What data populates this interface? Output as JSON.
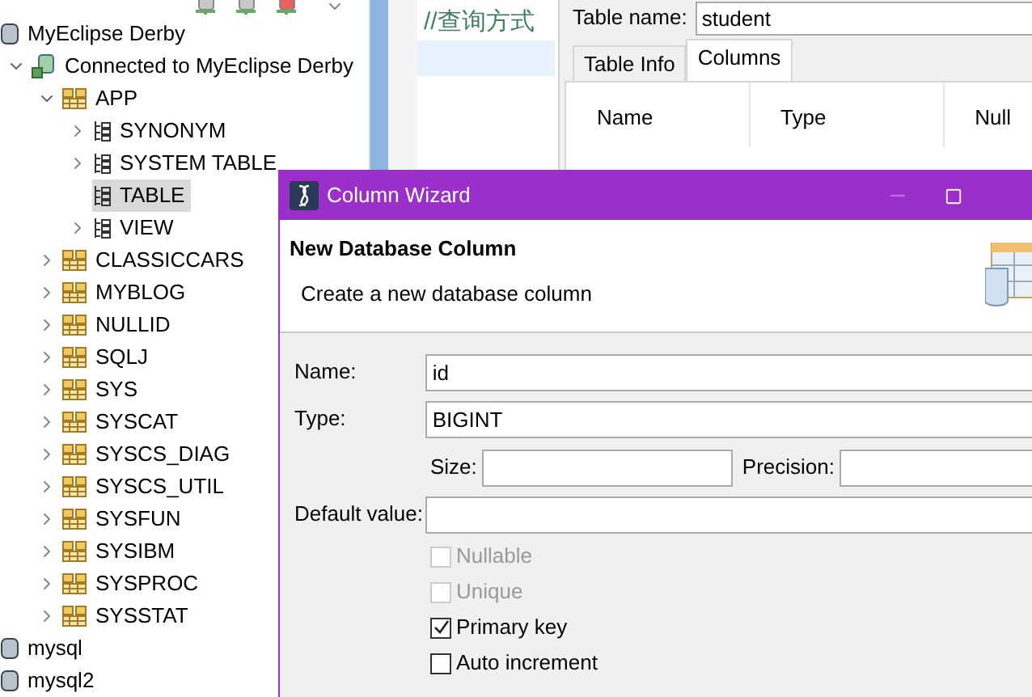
{
  "tree": [
    {
      "label": "MyEclipse Derby",
      "kind": "database",
      "selected": false,
      "children": [
        {
          "label": "Connected to MyEclipse Derby",
          "kind": "connection",
          "expanded": true,
          "selected": false,
          "children": [
            {
              "label": "APP",
              "kind": "schema",
              "expanded": true,
              "selected": false,
              "children": [
                {
                  "label": "SYNONYM",
                  "kind": "folder",
                  "expanded": false,
                  "selected": false
                },
                {
                  "label": "SYSTEM TABLE",
                  "kind": "folder",
                  "expanded": false,
                  "selected": false
                },
                {
                  "label": "TABLE",
                  "kind": "folder",
                  "selected": true
                },
                {
                  "label": "VIEW",
                  "kind": "folder",
                  "expanded": false,
                  "selected": false
                }
              ]
            },
            {
              "label": "CLASSICCARS",
              "kind": "schema",
              "expanded": false,
              "selected": false
            },
            {
              "label": "MYBLOG",
              "kind": "schema",
              "expanded": false,
              "selected": false
            },
            {
              "label": "NULLID",
              "kind": "schema",
              "expanded": false,
              "selected": false
            },
            {
              "label": "SQLJ",
              "kind": "schema",
              "expanded": false,
              "selected": false
            },
            {
              "label": "SYS",
              "kind": "schema",
              "expanded": false,
              "selected": false
            },
            {
              "label": "SYSCAT",
              "kind": "schema",
              "expanded": false,
              "selected": false
            },
            {
              "label": "SYSCS_DIAG",
              "kind": "schema",
              "expanded": false,
              "selected": false
            },
            {
              "label": "SYSCS_UTIL",
              "kind": "schema",
              "expanded": false,
              "selected": false
            },
            {
              "label": "SYSFUN",
              "kind": "schema",
              "expanded": false,
              "selected": false
            },
            {
              "label": "SYSIBM",
              "kind": "schema",
              "expanded": false,
              "selected": false
            },
            {
              "label": "SYSPROC",
              "kind": "schema",
              "expanded": false,
              "selected": false
            },
            {
              "label": "SYSSTAT",
              "kind": "schema",
              "expanded": false,
              "selected": false
            }
          ]
        }
      ]
    },
    {
      "label": "mysql",
      "kind": "database",
      "selected": false
    },
    {
      "label": "mysql2",
      "kind": "database",
      "selected": false
    }
  ],
  "editor": {
    "lines": [
      "//查询方式"
    ]
  },
  "table_dialog": {
    "table_name_label": "Table name:",
    "table_name": "student",
    "tabs": [
      {
        "label": "Table Info",
        "selected": false
      },
      {
        "label": "Columns",
        "selected": true
      }
    ],
    "columns": [
      "Name",
      "Type",
      "Null"
    ]
  },
  "wizard": {
    "title": "Column Wizard",
    "heading": "New Database Column",
    "subtitle": "Create a new database column",
    "name_label": "Name:",
    "name": "id",
    "type_label": "Type:",
    "type": "BIGINT",
    "size_label": "Size:",
    "precision_label": "Precision:",
    "default_label": "Default value:",
    "checkboxes": [
      {
        "label": "Nullable",
        "checked": false,
        "disabled": true
      },
      {
        "label": "Unique",
        "checked": false,
        "disabled": true
      },
      {
        "label": "Primary key",
        "checked": true,
        "disabled": false
      },
      {
        "label": "Auto increment",
        "checked": false,
        "disabled": false
      }
    ]
  }
}
